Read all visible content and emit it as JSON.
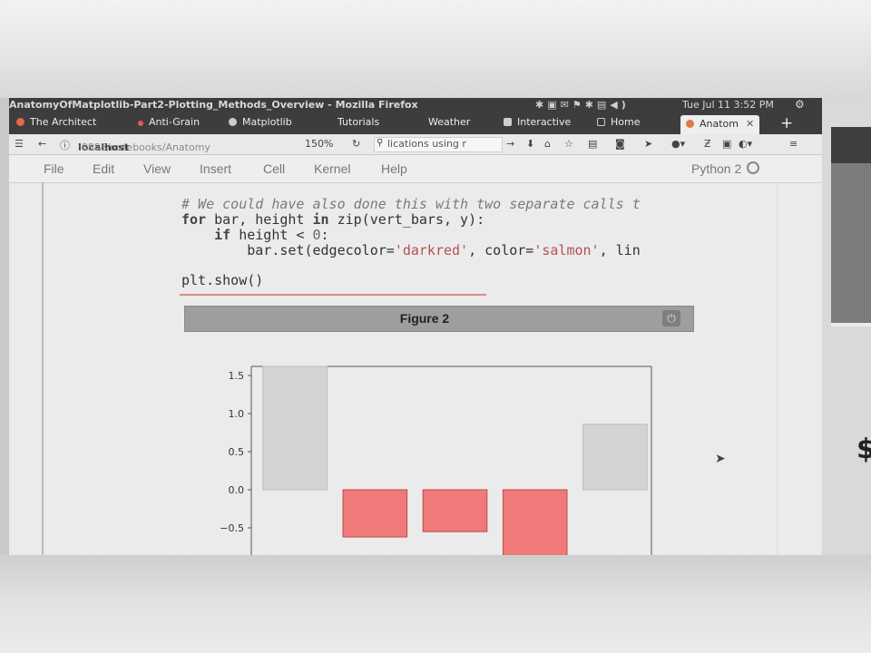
{
  "titlebar": {
    "title": "AnatomyOfMatplotlib-Part2-Plotting_Methods_Overview - Mozilla Firefox",
    "clock": "Tue Jul 11  3:52 PM"
  },
  "tabs": [
    {
      "label": "The Architect",
      "icon": "firefox-icon",
      "color": "#e06b4b"
    },
    {
      "label": "Anti-Grain",
      "icon": "dot-icon",
      "color": "#e05b5b"
    },
    {
      "label": "Matplotlib",
      "icon": "matplotlib-icon",
      "color": "#cccccc"
    },
    {
      "label": "Tutorials",
      "icon": "",
      "color": ""
    },
    {
      "label": "Weather",
      "icon": "",
      "color": ""
    },
    {
      "label": "Interactive",
      "icon": "",
      "color": ""
    },
    {
      "label": "Home",
      "icon": "",
      "color": ""
    },
    {
      "label": "Anatom",
      "icon": "jupyter-icon",
      "color": "#e07a4a",
      "active": true
    }
  ],
  "nav": {
    "url_host": "localhost",
    "url_path": ":8888/notebooks/Anatomy",
    "zoom": "150%",
    "search_value": "lications using r"
  },
  "menu": {
    "items": [
      "File",
      "Edit",
      "View",
      "Insert",
      "Cell",
      "Kernel",
      "Help"
    ],
    "kernel_label": "Python 2"
  },
  "code": {
    "line1": "# We could have also done this with two separate calls t",
    "line2_a": "for",
    "line2_b": " bar, height ",
    "line2_c": "in",
    "line2_d": " zip(vert_bars, y):",
    "line3_a": "    if",
    "line3_b": " height < ",
    "line3_c": "0",
    "line3_d": ":",
    "line4_a": "        bar.set(edgecolor=",
    "line4_b": "'darkred'",
    "line4_c": ", color=",
    "line4_d": "'salmon'",
    "line4_e": ", lin",
    "line5": "plt.show()"
  },
  "figure": {
    "title": "Figure 2"
  },
  "chart_data": {
    "type": "bar",
    "title": "",
    "xlabel": "",
    "ylabel": "",
    "ylim": [
      -0.9,
      1.65
    ],
    "yticks": [
      1.5,
      1.0,
      0.5,
      0.0,
      -0.5
    ],
    "ytick_labels": [
      "1.5",
      "1.0",
      "0.5",
      "0.0",
      "−0.5"
    ],
    "values": [
      1.62,
      -0.62,
      -0.55,
      -0.9,
      0.86
    ],
    "bar_colors": [
      "#d4d4d4",
      "#f07a7a",
      "#f07a7a",
      "#f07a7a",
      "#d4d4d4"
    ]
  }
}
